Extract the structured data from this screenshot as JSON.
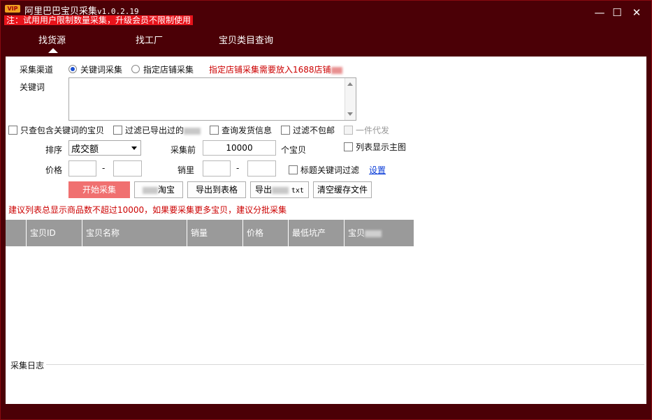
{
  "app": {
    "title": "阿里巴巴宝贝采集",
    "version": "v1.0.2.19",
    "badge": "VIP",
    "notice": "注：试用用户限制数量采集，升级会员不限制使用"
  },
  "window_controls": {
    "minimize": "—",
    "maximize": "☐",
    "close": "✕"
  },
  "tabs": [
    {
      "label": "找货源",
      "active": true
    },
    {
      "label": "找工厂",
      "active": false
    },
    {
      "label": "宝贝类目查询",
      "active": false
    }
  ],
  "form": {
    "channel_label": "采集渠道",
    "radio_keyword": "关键词采集",
    "radio_shop": "指定店铺采集",
    "shop_hint": "指定店铺采集需要放入1688店铺",
    "keyword_label": "关键词",
    "keyword_value": "",
    "cb_only_keyword": "只查包含关键词的宝贝",
    "cb_filter_exported": "过滤已导出过的",
    "cb_query_shipping": "查询发货信息",
    "cb_filter_no_freeship": "过滤不包邮",
    "cb_dropship": "一件代发",
    "sort_label": "排序",
    "sort_value": "成交额",
    "collect_top_label": "采集前",
    "collect_top_value": "10000",
    "collect_unit": "个宝贝",
    "cb_show_main_img": "列表显示主图",
    "price_label": "价格",
    "price_min": "",
    "price_max": "",
    "sales_label": "销里",
    "sales_min": "",
    "sales_max": "",
    "range_sep": "-",
    "cb_title_filter": "标题关键词过滤",
    "settings_link": "设置"
  },
  "buttons": {
    "start": "开始采集",
    "taobao": "淘宝",
    "export_table": "导出到表格",
    "export_txt_prefix": "导出",
    "export_txt_suffix": "txt",
    "clear_cache": "清空缓存文件"
  },
  "advice": "建议列表总显示商品数不超过10000，如果要采集更多宝贝，建议分批采集",
  "table": {
    "columns": [
      "",
      "宝贝ID",
      "宝贝名称",
      "销量",
      "价格",
      "最低坑产",
      "宝贝"
    ]
  },
  "log": {
    "label": "采集日志"
  }
}
